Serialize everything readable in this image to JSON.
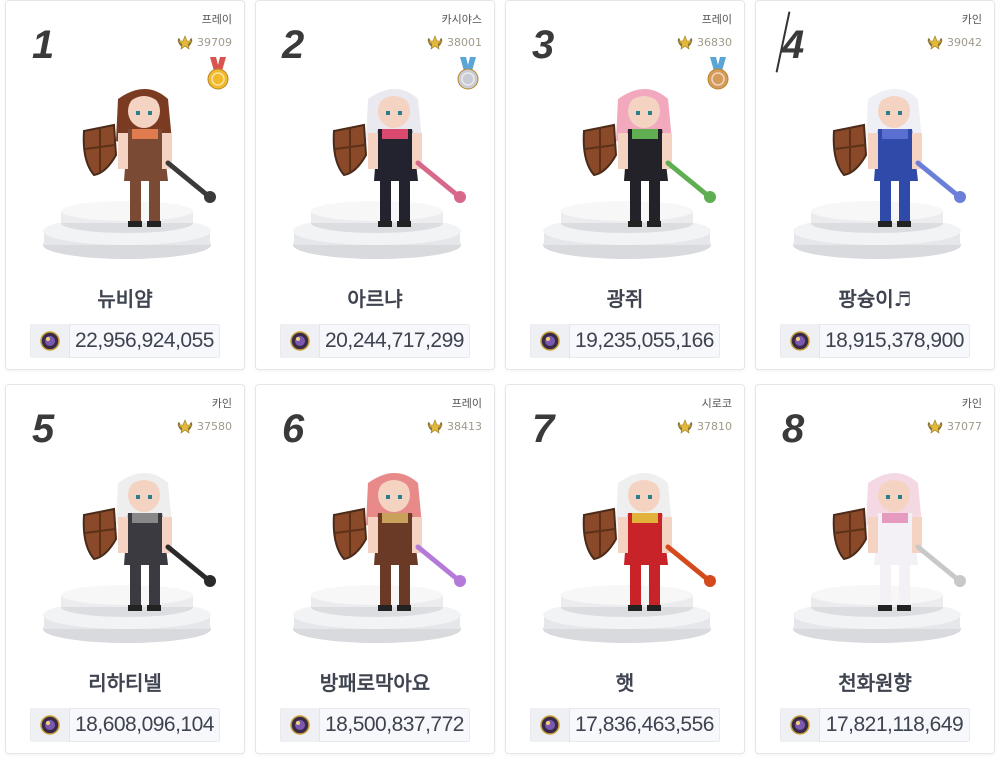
{
  "ranking": [
    {
      "rank": "1",
      "server": "프레이",
      "rp": "39709",
      "medal": "gold",
      "name": "뉴비얌",
      "gold": "22,956,924,055",
      "hair": "#7a3b22",
      "outfit": "#7b4a35",
      "accent": "#e07a4f",
      "weapon": "#3a3a3a"
    },
    {
      "rank": "2",
      "server": "카시야스",
      "rp": "38001",
      "medal": "silver",
      "name": "아르냐",
      "gold": "20,244,717,299",
      "hair": "#e9e9ef",
      "outfit": "#23232f",
      "accent": "#d94a6e",
      "weapon": "#d7688a"
    },
    {
      "rank": "3",
      "server": "프레이",
      "rp": "36830",
      "medal": "bronze",
      "name": "광쥐",
      "gold": "19,235,055,166",
      "hair": "#f2a9be",
      "outfit": "#222228",
      "accent": "#5fae52",
      "weapon": "#5fae52"
    },
    {
      "rank": "4",
      "server": "카인",
      "rp": "39042",
      "medal": "",
      "name": "팡슝이♬",
      "gold": "18,915,378,900",
      "hair": "#eef0f6",
      "outfit": "#2f4aa8",
      "accent": "#5a6fd1",
      "weapon": "#6b7fd9"
    },
    {
      "rank": "5",
      "server": "카인",
      "rp": "37580",
      "medal": "",
      "name": "리하티넬",
      "gold": "18,608,096,104",
      "hair": "#eeeeee",
      "outfit": "#3a3a40",
      "accent": "#888888",
      "weapon": "#2a2a2a"
    },
    {
      "rank": "6",
      "server": "프레이",
      "rp": "38413",
      "medal": "",
      "name": "방패로막아요",
      "gold": "18,500,837,772",
      "hair": "#e98a8a",
      "outfit": "#6b3a26",
      "accent": "#c9a15a",
      "weapon": "#b57ad9"
    },
    {
      "rank": "7",
      "server": "시로코",
      "rp": "37810",
      "medal": "",
      "name": "햇",
      "gold": "17,836,463,556",
      "hair": "#efefef",
      "outfit": "#c9232a",
      "accent": "#e0b23a",
      "weapon": "#d44a1c"
    },
    {
      "rank": "8",
      "server": "카인",
      "rp": "37077",
      "medal": "",
      "name": "천화원향",
      "gold": "17,821,118,649",
      "hair": "#f4d9e4",
      "outfit": "#f3f0f6",
      "accent": "#e79ac0",
      "weapon": "#c8c8c8"
    }
  ],
  "colors": {
    "gold_medal": "#f2b92a",
    "silver_medal": "#c9ccd3",
    "bronze_medal": "#d59b5c",
    "ribbon_red": "#d9534f",
    "ribbon_blue": "#5aa5d6"
  }
}
